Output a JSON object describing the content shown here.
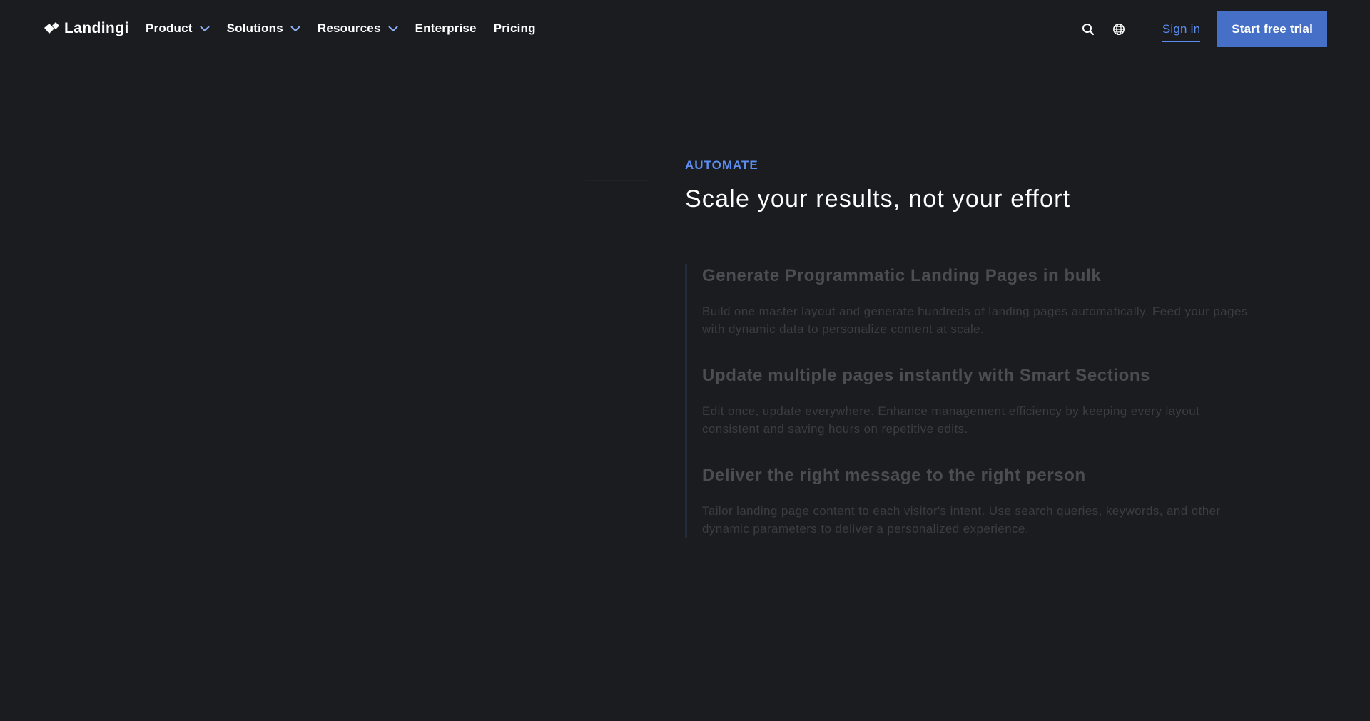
{
  "brand": {
    "name": "Landingi"
  },
  "nav": {
    "items": [
      {
        "label": "Product",
        "has_dropdown": true
      },
      {
        "label": "Solutions",
        "has_dropdown": true
      },
      {
        "label": "Resources",
        "has_dropdown": true
      },
      {
        "label": "Enterprise",
        "has_dropdown": false
      },
      {
        "label": "Pricing",
        "has_dropdown": false
      }
    ]
  },
  "header": {
    "icons": [
      "search-icon",
      "globe-icon"
    ],
    "signin_label": "Sign in",
    "cta_label": "Start free trial"
  },
  "section": {
    "eyebrow": "AUTOMATE",
    "headline": "Scale your results, not your effort",
    "features": [
      {
        "title": "Generate Programmatic Landing Pages in bulk",
        "body": "Build one master layout and generate hundreds of landing pages automatically. Feed your pages with dynamic data to personalize content at scale."
      },
      {
        "title": "Update multiple pages instantly with Smart Sections",
        "body": "Edit once, update everywhere. Enhance management efficiency by keeping every layout consistent and saving hours on repetitive edits."
      },
      {
        "title": "Deliver the right message to the right person",
        "body": "Tailor landing page content to each visitor's intent. Use search queries, keywords, and other dynamic parameters to deliver a personalized experience."
      }
    ]
  },
  "colors": {
    "background": "#1b1c20",
    "accent": "#5b8ef0",
    "cta": "#4670c7",
    "muted_title": "#4b4d52",
    "muted_body": "#3b3d42"
  }
}
